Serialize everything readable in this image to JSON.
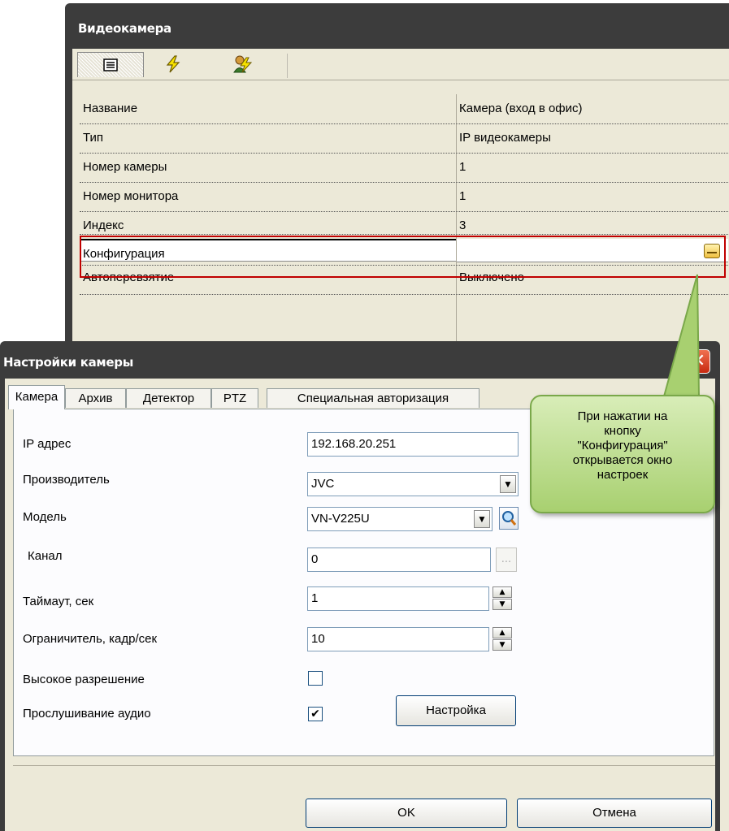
{
  "camera_window": {
    "title": "Видеокамера",
    "toolbar": {
      "icons": [
        "properties-icon",
        "lightning-icon",
        "users-icon"
      ]
    },
    "properties": [
      {
        "key": "Название",
        "value": "Камера (вход в офис)"
      },
      {
        "key": "Тип",
        "value": "IP видеокамеры"
      },
      {
        "key": "Номер камеры",
        "value": "1"
      },
      {
        "key": "Номер монитора",
        "value": "1"
      },
      {
        "key": "Индекс",
        "value": "3"
      },
      {
        "key": "Конфигурация",
        "value": ""
      },
      {
        "key": "Автоперевзятие",
        "value": "Выключено"
      }
    ]
  },
  "settings_dialog": {
    "title": "Настройки камеры",
    "close_label": "✕",
    "tabs": [
      "Камера",
      "Архив",
      "Детектор",
      "PTZ",
      "Специальная авторизация"
    ],
    "fields": {
      "ip_label": "IP адрес",
      "ip_value": "192.168.20.251",
      "vendor_label": "Производитель",
      "vendor_value": "JVC",
      "model_label": "Модель",
      "model_value": "VN-V225U",
      "channel_label": "Канал",
      "channel_value": "0",
      "timeout_label": "Таймаут, сек",
      "timeout_value": "1",
      "limiter_label": "Ограничитель, кадр/сек",
      "limiter_value": "10",
      "hires_label": "Высокое разрешение",
      "hires_checked": false,
      "audio_label": "Прослушивание аудио",
      "audio_checked": true,
      "setup_button": "Настройка",
      "small_ellipsis": "..."
    },
    "footer": {
      "ok": "OK",
      "cancel": "Отмена"
    }
  },
  "callout": {
    "lines": [
      "При нажатии на",
      "кнопку",
      "\"Конфигурация\"",
      "открывается окно",
      "настроек"
    ]
  },
  "colors": {
    "window_chrome": "#3c3c3c",
    "panel": "#ece9d8",
    "highlight_box": "#c00000",
    "callout_fill": "#a8d070",
    "close_button": "#c82a10"
  }
}
